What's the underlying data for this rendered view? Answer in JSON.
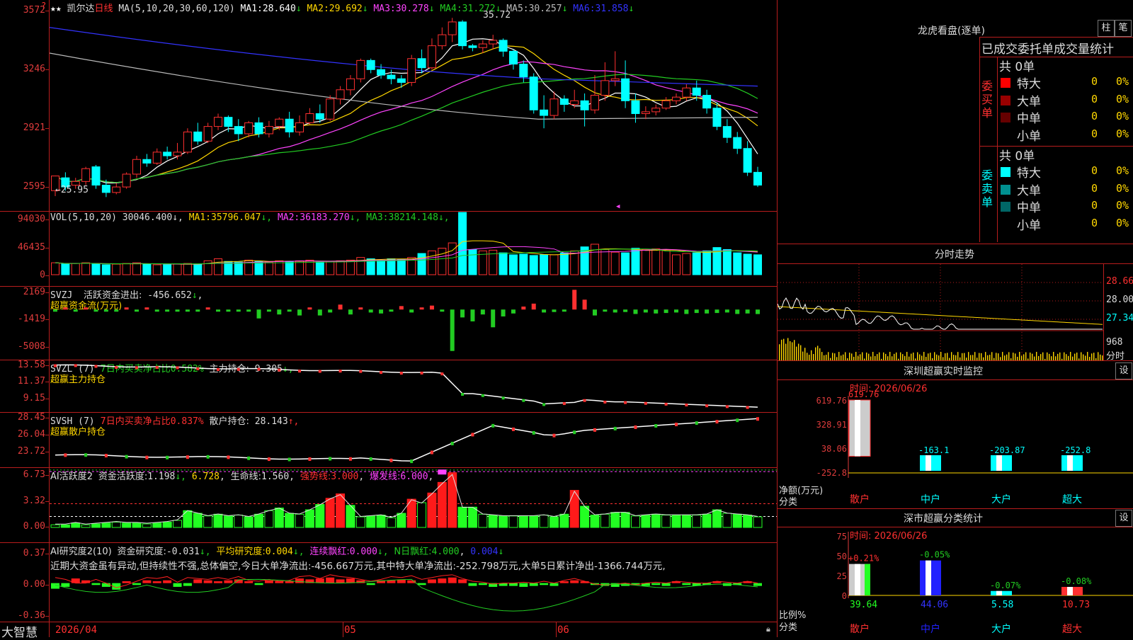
{
  "app": {
    "brand": "大智慧",
    "stock_name": "凯尔达",
    "period": "日线",
    "star": "★"
  },
  "colors": {
    "up": "#ff3030",
    "down": "#00ffff",
    "ma1": "#ffffff",
    "ma2": "#ffd700",
    "ma3": "#ff44ff",
    "ma4": "#22cc22",
    "ma5": "#bbbbbb",
    "ma6": "#3333ff",
    "axis": "#e03c3c",
    "grid": "#b81d1d"
  },
  "kline": {
    "ma_header": "MA(5,10,20,30,60,120)",
    "ma_values": [
      {
        "name": "MA1:",
        "value": "28.640",
        "arrow": "↓",
        "color": "#ffffff"
      },
      {
        "name": "MA2:",
        "value": "29.692",
        "arrow": "↓",
        "color": "#ffd700"
      },
      {
        "name": "MA3:",
        "value": "30.278",
        "arrow": "↓",
        "color": "#ff44ff"
      },
      {
        "name": "MA4:",
        "value": "31.272",
        "arrow": "↓",
        "color": "#22cc22"
      },
      {
        "name": "MA5:",
        "value": "30.257",
        "arrow": "↓",
        "color": "#bbbbbb"
      },
      {
        "name": "MA6:",
        "value": "31.858",
        "arrow": "↓",
        "color": "#3333ff"
      }
    ],
    "y_ticks": [
      "3572",
      "3246",
      "2921",
      "2595"
    ],
    "high_label": "35.72",
    "low_label": "←25.95"
  },
  "vol": {
    "header": "VOL(5,10,20)",
    "value": "30046.400",
    "ma": [
      {
        "name": "MA1:",
        "value": "35796.047",
        "arrow": "↓",
        "color": "#ffd700"
      },
      {
        "name": "MA2:",
        "value": "36183.270",
        "arrow": "↓",
        "color": "#ff44ff"
      },
      {
        "name": "MA3:",
        "value": "38214.148",
        "arrow": "↓",
        "color": "#22cc22"
      }
    ],
    "y_ticks": [
      "94030",
      "46435",
      "0"
    ]
  },
  "svzj": {
    "header": "SVZJ",
    "label1": "活跃资金进出:",
    "value1": "-456.652",
    "arrow1": "↓",
    "sub": "超赢资金流(万元)",
    "y_ticks": [
      "2169",
      "-1419",
      "-5008"
    ]
  },
  "svzl": {
    "header": "SVZL (7)",
    "label1": "7日内买卖净占比",
    "value1": "0.582%",
    "label2": "主力持仓:",
    "value2": "9.305",
    "arrow2": "↓,",
    "sub": "超赢主力持仓",
    "y_ticks": [
      "13.58",
      "11.37",
      "9.15"
    ]
  },
  "svsh": {
    "header": "SVSH (7)",
    "label1": "7日内买卖净占比",
    "value1": "0.837%",
    "label2": "散户持仓:",
    "value2": "28.143",
    "arrow2": "↑,",
    "sub": "超赢散户持仓",
    "y_ticks": [
      "28.45",
      "26.04",
      "23.72"
    ]
  },
  "ai_active": {
    "header": "AI活跃度2",
    "l1": "资金活跃度:",
    "v1": "1.198",
    "a1": "↓,",
    "v2": "6.728",
    "a2": ",",
    "l3": "生命线:",
    "v3": "1.560",
    "a3": ",",
    "l4": "强势线:",
    "v4": "3.000",
    "a4": ",",
    "l5": "爆发线:",
    "v5": "6.000",
    "a5": ",",
    "y_ticks": [
      "6.73",
      "3.32",
      "0.00"
    ]
  },
  "ai_research": {
    "header": "AI研究度2(10)",
    "l1": "资金研究度:",
    "v1": "-0.031",
    "a1": "↓,",
    "l2": "平均研究度:",
    "v2": "0.004",
    "a2": "↓,",
    "l3": "连续飘红:",
    "v3": "0.000",
    "a3": "↓,",
    "l4": "N日飘红:",
    "v4": "4.000",
    "a4": ",",
    "v5": "0.004",
    "a5": "↓",
    "comment": "近期大资金虽有异动,但持续性不强,总体偏空,今日大单净流出:-456.667万元,其中特大单净流出:-252.798万元,大单5日累计净出-1366.744万元,",
    "y_ticks": [
      "0.37",
      "0.00",
      "-0.36"
    ]
  },
  "xaxis": {
    "labels": [
      "2026/04",
      "05",
      "06"
    ]
  },
  "longhu": {
    "title": "龙虎看盘(逐单)",
    "btn_zhu": "柱",
    "btn_bi": "笔",
    "subtitle": "已成交委托单成交量统计",
    "buy": {
      "side": "委买单",
      "total": "共 0单",
      "rows": [
        {
          "name": "特大",
          "vol": "0",
          "pct": "0%",
          "color": "#ff0000"
        },
        {
          "name": "大单",
          "vol": "0",
          "pct": "0%",
          "color": "#990000"
        },
        {
          "name": "中单",
          "vol": "0",
          "pct": "0%",
          "color": "#660000"
        },
        {
          "name": "小单",
          "vol": "0",
          "pct": "0%",
          "color": ""
        }
      ]
    },
    "sell": {
      "side": "委卖单",
      "total": "共 0单",
      "rows": [
        {
          "name": "特大",
          "vol": "0",
          "pct": "0%",
          "color": "#00ffff"
        },
        {
          "name": "大单",
          "vol": "0",
          "pct": "0%",
          "color": "#008f8f"
        },
        {
          "name": "中单",
          "vol": "0",
          "pct": "0%",
          "color": "#006666"
        },
        {
          "name": "小单",
          "vol": "0",
          "pct": "0%",
          "color": ""
        }
      ]
    }
  },
  "intraday": {
    "title": "分时走势",
    "y_labels": [
      "28.66",
      "28.00",
      "27.34"
    ],
    "vol_label": "968",
    "vol_unit": "分时"
  },
  "sz_monitor": {
    "title": "深圳超赢实时监控",
    "btn": "设",
    "time_label": "时间: 2026/06/26",
    "y_ticks": [
      "619.76",
      "328.91",
      "38.06",
      "-252.8"
    ],
    "side_label1": "净额(万元)",
    "side_label2": "分类",
    "bars": [
      {
        "label": "散户",
        "value": "619.76"
      },
      {
        "label": "中户",
        "value": "-163.1"
      },
      {
        "label": "大户",
        "value": "-203.87"
      },
      {
        "label": "超大",
        "value": "-252.8"
      }
    ]
  },
  "sz_classify": {
    "title": "深市超赢分类统计",
    "btn": "设",
    "time_label": "时间: 2026/06/26",
    "y_ticks": [
      "75",
      "50",
      "25",
      "0"
    ],
    "side_label1": "比例%",
    "side_label2": "分类",
    "bars": [
      {
        "label": "散户",
        "change": "+0.21%",
        "value": "39.64"
      },
      {
        "label": "中户",
        "change": "-0.05%",
        "value": "44.06"
      },
      {
        "label": "大户",
        "change": "-0.07%",
        "value": "5.58"
      },
      {
        "label": "超大",
        "change": "-0.08%",
        "value": "10.73"
      }
    ]
  }
}
